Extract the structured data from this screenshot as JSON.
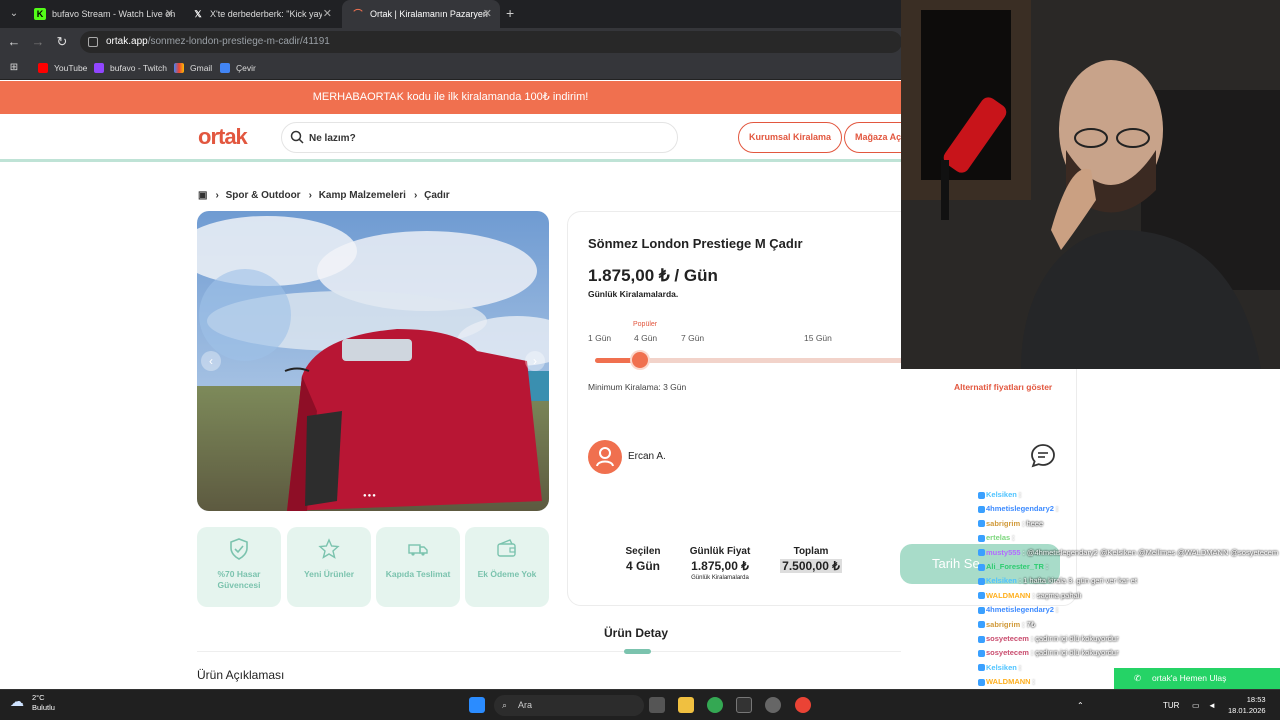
{
  "browser": {
    "tabs": [
      {
        "title": "bufavo Stream - Watch Live on"
      },
      {
        "title": "X'te derbederberk: \"Kick yayıncı"
      },
      {
        "title": "Ortak | Kiralamanın Pazaryeri"
      }
    ],
    "url_host": "ortak.app",
    "url_path": "/sonmez-london-prestiege-m-cadir/41191",
    "bookmarks": [
      "YouTube",
      "bufavo - Twitch",
      "Gmail",
      "Çevir"
    ]
  },
  "site": {
    "promo": "MERHABAORTAK kodu ile ilk kiralamanda 100₺ indirim!",
    "logo": "ortak",
    "search_placeholder": "Ne lazım?",
    "corporate_btn": "Kurumsal Kiralama",
    "store_btn": "Mağaza Aç",
    "breadcrumbs": [
      "Spor & Outdoor",
      "Kamp Malzemeleri",
      "Çadır"
    ],
    "features": [
      {
        "label": "%70 Hasar Güvencesi",
        "icon": "shield-check-icon"
      },
      {
        "label": "Yeni Ürünler",
        "icon": "star-icon"
      },
      {
        "label": "Kapıda Teslimat",
        "icon": "truck-icon"
      },
      {
        "label": "Ek Ödeme Yok",
        "icon": "wallet-icon"
      }
    ],
    "product": {
      "title": "Sönmez London Prestiege M Çadır",
      "price": "1.875,00 ₺ / Gün",
      "price_note": "Günlük Kiralamalarda.",
      "popular_badge": "Popüler",
      "duration_labels": [
        "1 Gün",
        "4 Gün",
        "7 Gün",
        "15 Gün"
      ],
      "selected_duration_fraction": 0.14,
      "min_rental": "Minimum Kiralama: 3 Gün",
      "alt_prices": "Alternatif fiyatları göster",
      "owner": "Ercan A.",
      "summary": {
        "selected_label": "Seçilen",
        "selected_value": "4 Gün",
        "daily_label": "Günlük Fiyat",
        "daily_value": "1.875,00 ₺",
        "daily_note": "Günlük Kiralamalarda",
        "total_label": "Toplam",
        "total_value": "7.500,00 ₺"
      },
      "date_button": "Tarih Se"
    },
    "detail_tab": "Ürün Detay",
    "description_heading": "Ürün Açıklaması",
    "whatsapp": "ortak'a Hemen Ulaş"
  },
  "chat": [
    {
      "user": "Kelsiken",
      "msg": ":",
      "color": "#4ec3ff"
    },
    {
      "user": "4hmetislegendary2",
      "msg": ":",
      "color": "#3d8bff"
    },
    {
      "user": "sabrigrim",
      "msg": ": heee",
      "color": "#d19a3a"
    },
    {
      "user": "ertelas",
      "msg": ":",
      "color": "#7cd67c"
    },
    {
      "user": "musty555",
      "msg": ": @4hmetislegendary2 @Kelsiken @Mellimes @WALDMANN @sosyetecem",
      "color": "#b36bff"
    },
    {
      "user": "Ali_Forester_TR",
      "msg": ":",
      "color": "#2ecc71"
    },
    {
      "user": "Kelsiken",
      "msg": ": 1 hafta kirala 3. gün geri ver kar et",
      "color": "#4ec3ff"
    },
    {
      "user": "WALDMANN",
      "msg": ": saçma pahalı",
      "color": "#ffb020"
    },
    {
      "user": "4hmetislegendary2",
      "msg": ":",
      "color": "#3d8bff"
    },
    {
      "user": "sabrigrim",
      "msg": ": 7₺",
      "color": "#d19a3a"
    },
    {
      "user": "sosyetecem",
      "msg": ": çadırın içi ölü kokuyordur",
      "color": "#c94c6e"
    },
    {
      "user": "sosyetecem",
      "msg": ": çadırın içi ölü kokuyordur",
      "color": "#c94c6e"
    },
    {
      "user": "Kelsiken",
      "msg": ":",
      "color": "#4ec3ff"
    },
    {
      "user": "WALDMANN",
      "msg": ":",
      "color": "#ffb020"
    }
  ],
  "taskbar": {
    "temp": "2°C",
    "weather": "Bulutlu",
    "search": "Ara",
    "lang": "TUR",
    "time": "18:53",
    "date": "18.01.2026"
  }
}
